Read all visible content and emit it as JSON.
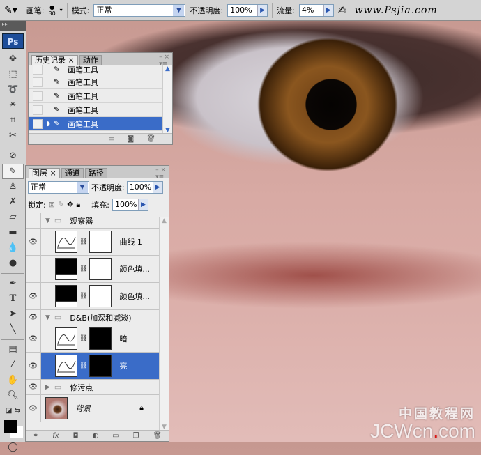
{
  "options_bar": {
    "brush_label": "画笔:",
    "brush_size": "30",
    "mode_label": "模式:",
    "mode_value": "正常",
    "opacity_label": "不透明度:",
    "opacity_value": "100%",
    "flow_label": "流量:",
    "flow_value": "4%",
    "watermark": "www.Psjia.com"
  },
  "toolbox": {
    "logo": "Ps",
    "tools": [
      "move",
      "marquee",
      "lasso",
      "magic-wand",
      "crop",
      "slice",
      "healing",
      "brush",
      "stamp",
      "history-brush",
      "eraser",
      "gradient",
      "blur",
      "dodge",
      "pen",
      "type",
      "path-select",
      "line",
      "notes",
      "eyedropper",
      "hand",
      "zoom"
    ]
  },
  "history": {
    "tabs": [
      "历史记录",
      "动作"
    ],
    "items": [
      "画笔工具",
      "画笔工具",
      "画笔工具",
      "画笔工具",
      "画笔工具"
    ],
    "selected_index": 4
  },
  "layers": {
    "tabs": [
      "图层",
      "通道",
      "路径"
    ],
    "blend_mode": "正常",
    "opacity_label": "不透明度:",
    "opacity_value": "100%",
    "lock_label": "锁定:",
    "fill_label": "填充:",
    "fill_value": "100%",
    "rows": [
      {
        "name": "观察器",
        "type": "group",
        "visible": false
      },
      {
        "name": "曲线 1",
        "type": "curves",
        "visible": true
      },
      {
        "name": "颜色填...",
        "type": "fill",
        "visible": false
      },
      {
        "name": "颜色填...",
        "type": "fill",
        "visible": true
      },
      {
        "name": "D&B(加深和减淡)",
        "type": "group",
        "visible": true
      },
      {
        "name": "暗",
        "type": "curves",
        "visible": true
      },
      {
        "name": "亮",
        "type": "curves",
        "visible": true,
        "selected": true
      },
      {
        "name": "修污点",
        "type": "group",
        "visible": true
      },
      {
        "name": "背景",
        "type": "background",
        "visible": true
      }
    ]
  },
  "watermark": {
    "cn": "中国教程网",
    "en": "JCWcn",
    "dot": ".",
    "tld": "com"
  }
}
